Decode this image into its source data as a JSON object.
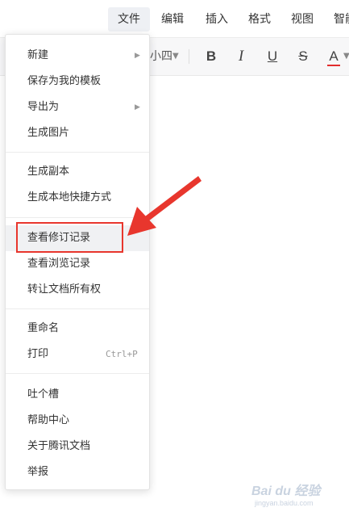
{
  "menubar": {
    "items": [
      {
        "label": "文件",
        "active": true
      },
      {
        "label": "编辑"
      },
      {
        "label": "插入"
      },
      {
        "label": "格式"
      },
      {
        "label": "视图"
      },
      {
        "label": "智能"
      }
    ]
  },
  "toolbar": {
    "font_size": "小四",
    "bold": "B",
    "italic": "I",
    "underline": "U",
    "strike": "S",
    "font_color": "A",
    "font_color_hex": "#e22d2d"
  },
  "file_menu": {
    "groups": [
      [
        {
          "label": "新建",
          "submenu": true
        },
        {
          "label": "保存为我的模板"
        },
        {
          "label": "导出为",
          "submenu": true
        },
        {
          "label": "生成图片"
        }
      ],
      [
        {
          "label": "生成副本"
        },
        {
          "label": "生成本地快捷方式"
        }
      ],
      [
        {
          "label": "查看修订记录",
          "highlighted": true
        },
        {
          "label": "查看浏览记录"
        },
        {
          "label": "转让文档所有权"
        }
      ],
      [
        {
          "label": "重命名"
        },
        {
          "label": "打印",
          "shortcut": "Ctrl+P"
        }
      ],
      [
        {
          "label": "吐个槽"
        },
        {
          "label": "帮助中心"
        },
        {
          "label": "关于腾讯文档"
        },
        {
          "label": "举报"
        }
      ]
    ]
  },
  "annotation": {
    "color": "#e8362d"
  },
  "watermark": {
    "brand": "Bai du 经验",
    "url": "jingyan.baidu.com"
  }
}
